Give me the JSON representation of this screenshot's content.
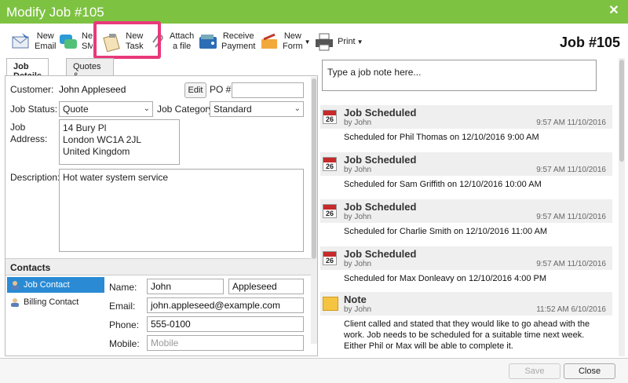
{
  "window": {
    "title": "Modify Job #105",
    "job_title": "Job #105"
  },
  "toolbar": {
    "new_email": [
      "New",
      "Email"
    ],
    "new_sms": [
      "New",
      "SMS"
    ],
    "new_task": [
      "New",
      "Task"
    ],
    "attach_file": [
      "Attach",
      "a file"
    ],
    "receive_payment": [
      "Receive",
      "Payment"
    ],
    "new_form": [
      "New",
      "Form"
    ],
    "print": "Print"
  },
  "tabs": [
    "Job Details",
    "Quotes & Invoicing"
  ],
  "form": {
    "customer_label": "Customer:",
    "customer_value": "John Appleseed",
    "edit_button": "Edit",
    "po_label": "PO #",
    "po_value": "",
    "status_label": "Job Status:",
    "status_value": "Quote",
    "category_label": "Job Category",
    "category_value": "Standard",
    "address_label": [
      "Job",
      "Address:"
    ],
    "address_lines": [
      "14 Bury Pl",
      "London WC1A 2JL",
      "United Kingdom"
    ],
    "description_label": "Description:",
    "description_value": "Hot water system service"
  },
  "contacts": {
    "header": "Contacts",
    "items": [
      "Job Contact",
      "Billing Contact"
    ],
    "name_label": "Name:",
    "first_name": "John",
    "last_name": "Appleseed",
    "email_label": "Email:",
    "email": "john.appleseed@example.com",
    "phone_label": "Phone:",
    "phone": "555-0100",
    "mobile_label": "Mobile:",
    "mobile_placeholder": "Mobile"
  },
  "notes": {
    "placeholder": "Type a job note here...",
    "entries": [
      {
        "title": "Job Scheduled",
        "by": "by John",
        "time": "9:57 AM 11/10/2016",
        "body": "Scheduled for Phil Thomas on 12/10/2016 9:00 AM",
        "icon": "calendar-icon",
        "day": "26"
      },
      {
        "title": "Job Scheduled",
        "by": "by John",
        "time": "9:57 AM 11/10/2016",
        "body": "Scheduled for Sam Griffith on 12/10/2016 10:00 AM",
        "icon": "calendar-icon",
        "day": "26"
      },
      {
        "title": "Job Scheduled",
        "by": "by John",
        "time": "9:57 AM 11/10/2016",
        "body": "Scheduled for Charlie Smith on 12/10/2016 11:00 AM",
        "icon": "calendar-icon",
        "day": "26"
      },
      {
        "title": "Job Scheduled",
        "by": "by John",
        "time": "9:57 AM 11/10/2016",
        "body": "Scheduled for Max Donleavy on 12/10/2016 4:00 PM",
        "icon": "calendar-icon",
        "day": "26"
      },
      {
        "title": "Note",
        "by": "by John",
        "time": "11:52 AM 6/10/2016",
        "body": "Client called and stated that they would like to go ahead with the work. Job needs to be scheduled for a suitable time next week. Either Phil or Max will be able to complete it.",
        "icon": "note-icon"
      }
    ]
  },
  "footer": {
    "save": "Save",
    "close": "Close"
  },
  "colors": {
    "titlebar": "#7ec242",
    "highlight": "#e8397a",
    "selected": "#2a8ad4",
    "calendar_red": "#c62a2a"
  }
}
